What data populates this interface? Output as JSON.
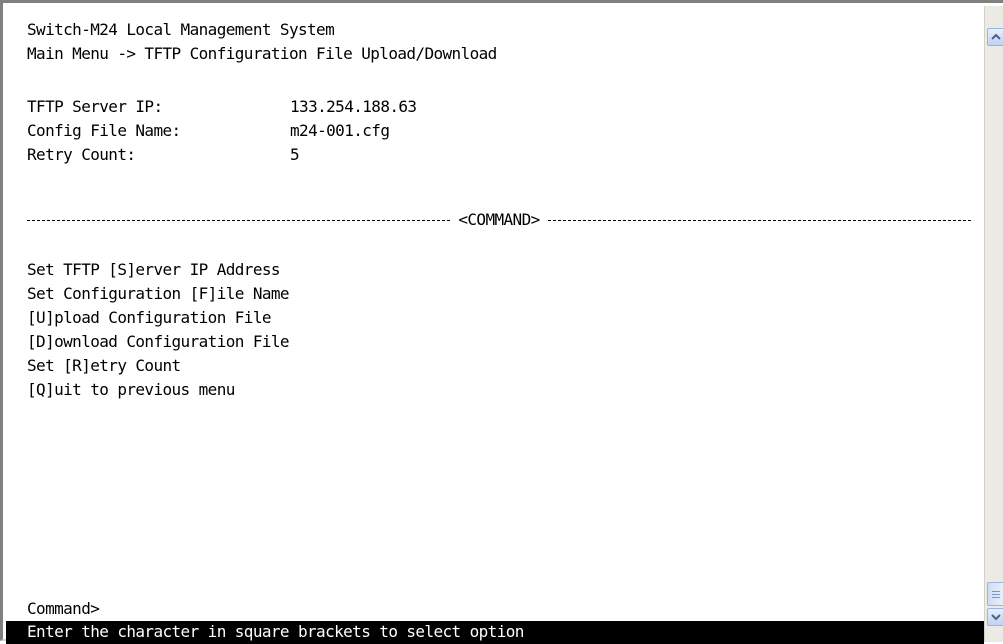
{
  "header": {
    "system_title": "Switch-M24 Local Management System",
    "breadcrumb": "Main Menu -> TFTP Configuration File Upload/Download"
  },
  "settings": [
    {
      "label": "TFTP Server IP:",
      "value": "133.254.188.63"
    },
    {
      "label": "Config File Name:",
      "value": "m24-001.cfg"
    },
    {
      "label": "Retry Count:",
      "value": "5"
    }
  ],
  "divider": {
    "label": "<COMMAND>"
  },
  "commands": [
    {
      "label": "Set TFTP [S]erver IP Address"
    },
    {
      "label": "Set Configuration [F]ile Name"
    },
    {
      "label": "[U]pload Configuration File"
    },
    {
      "label": "[D]ownload Configuration File"
    },
    {
      "label": "Set [R]etry Count"
    },
    {
      "label": "[Q]uit to previous menu"
    }
  ],
  "prompt": {
    "text": "Command>"
  },
  "status_bar": {
    "text": "Enter the character in square brackets to select option"
  },
  "scrollbar": {
    "up_icon": "arrow-up-icon",
    "down_icon": "arrow-down-icon"
  },
  "colors": {
    "background": "#ffffff",
    "text": "#000000",
    "status_bar_bg": "#000000",
    "status_bar_text": "#ffffff"
  }
}
